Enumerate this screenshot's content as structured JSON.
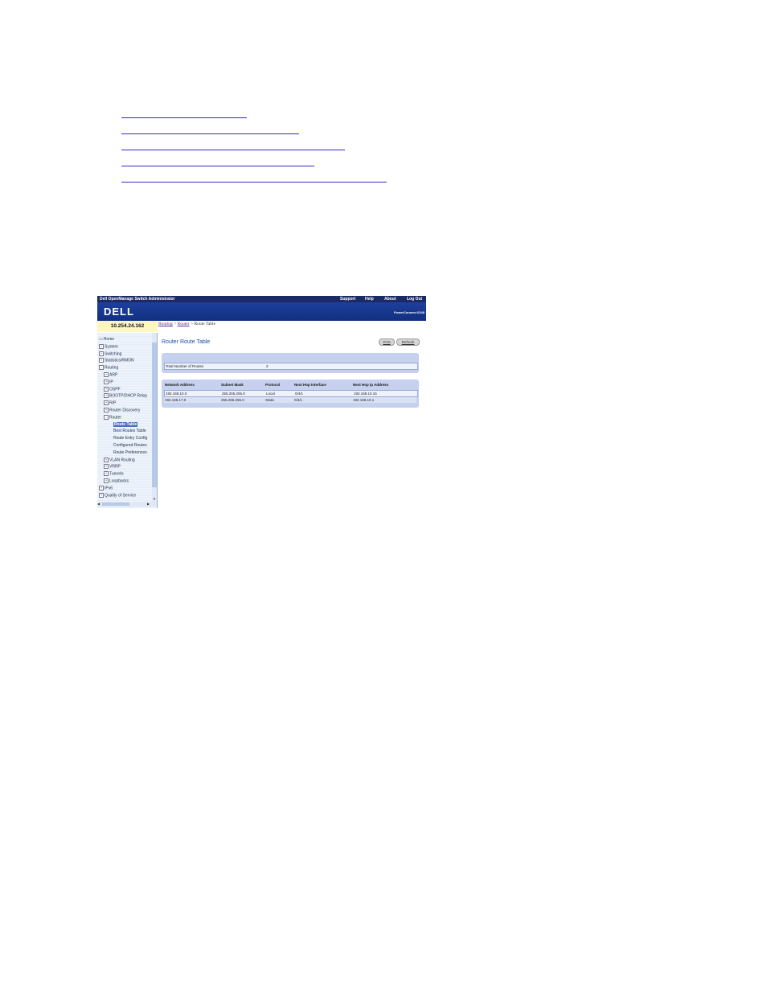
{
  "colors": {
    "top_bar": "#1b2a64",
    "banner": "#1e3f9e",
    "ip_bar": "#fff6c0",
    "nav_background": "#e8f0fa",
    "panel": "#c5d1ee",
    "selected_nav": "#4a6fc1",
    "title_blue": "#1d4fa0"
  },
  "header": {
    "app_title": "Dell OpenManage Switch Administrator",
    "links": [
      "Support",
      "Help",
      "About",
      "Log Out"
    ],
    "logo": "DELL",
    "model": "PowerConnect 6248"
  },
  "ip_address": "10.254.24.162",
  "breadcrumb": {
    "items": [
      "Routing",
      "Router",
      "Route Table"
    ],
    "separator": ">"
  },
  "nav": [
    {
      "label": "Home",
      "toggle": "",
      "icon": "home-icon"
    },
    {
      "label": "System",
      "toggle": "+"
    },
    {
      "label": "Switching",
      "toggle": "+"
    },
    {
      "label": "Statistics/RMON",
      "toggle": "+"
    },
    {
      "label": "Routing",
      "toggle": "-"
    },
    {
      "label": "ARP",
      "toggle": "+"
    },
    {
      "label": "IP",
      "toggle": "+"
    },
    {
      "label": "OSPF",
      "toggle": "+"
    },
    {
      "label": "BOOTP/DHCP Relay",
      "toggle": "+"
    },
    {
      "label": "RIP",
      "toggle": "+"
    },
    {
      "label": "Router Discovery",
      "toggle": "+"
    },
    {
      "label": "Router",
      "toggle": "-"
    },
    {
      "label": "Route Table",
      "toggle": "",
      "selected": true
    },
    {
      "label": "Best Routes Table",
      "toggle": ""
    },
    {
      "label": "Route Entry Config",
      "toggle": ""
    },
    {
      "label": "Configured Routes",
      "toggle": ""
    },
    {
      "label": "Route Preferences",
      "toggle": ""
    },
    {
      "label": "VLAN Routing",
      "toggle": "+"
    },
    {
      "label": "VRRP",
      "toggle": "+"
    },
    {
      "label": "Tunnels",
      "toggle": "+"
    },
    {
      "label": "Loopbacks",
      "toggle": "+"
    },
    {
      "label": "IPv6",
      "toggle": "+"
    },
    {
      "label": "Quality of Service",
      "toggle": "+"
    }
  ],
  "main": {
    "title": "Router Route Table",
    "buttons": {
      "print": "Print",
      "refresh": "Refresh"
    },
    "summary": {
      "label": "Total Number of Routes",
      "value": "2"
    },
    "table": {
      "columns": [
        "Network Address",
        "Subnet Mask",
        "Protocol",
        "Next Hop Interface",
        "Next Hop Ip Address"
      ],
      "rows": [
        [
          "192.168.10.0",
          "255.255.255.0",
          "Local",
          "0/4/1",
          "192.168.10.15"
        ],
        [
          "192.168.17.0",
          "255.255.255.0",
          "Static",
          "0/4/1",
          "192.168.10.1"
        ]
      ]
    }
  }
}
